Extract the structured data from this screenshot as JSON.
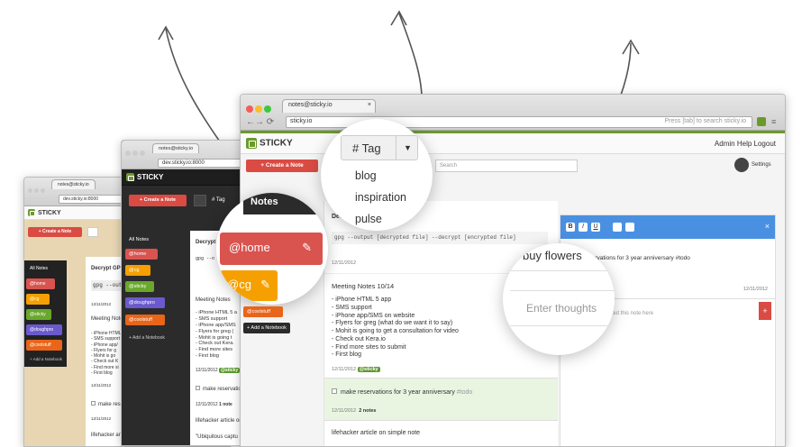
{
  "colors": {
    "brand": "#6a9a2a",
    "red": "#d94b43",
    "home": "#d9534f",
    "cg": "#f5a000",
    "sticky": "#6aa82c",
    "doughpro": "#6a5acd",
    "coolstuff": "#e8651a",
    "modal": "#4a90e2"
  },
  "back": {
    "tab": "notes@sticky.io",
    "url": "dev.sticky.io:8000",
    "logo": "STICKY",
    "create": "+ Create a Note",
    "notebooks": [
      "All Notes",
      "@home",
      "@cg",
      "@sticky",
      "@doughpro",
      "@coolstuff"
    ],
    "add": "+ Add a Notebook",
    "n1_title": "Decrypt GPG",
    "n1_body": "gpg --outpu",
    "n1_date": "12/11/2012",
    "n2_title": "Meeting Notes",
    "n2_lines": [
      "- iPhone HTML",
      "- SMS support",
      "- iPhone app/",
      "- Flyers for g",
      "- Mohit is go",
      "- Check out K",
      "- Find more si",
      "- First blog"
    ],
    "n2_date": "12/11/2012",
    "n3": "make reserv",
    "n3_date": "12/11/2012",
    "n4": "lifehacker art"
  },
  "mid": {
    "tab": "notes@sticky.io",
    "url": "dev.sticky.io:8000",
    "logo": "STICKY",
    "create": "+ Create a Note",
    "tag": "# Tag",
    "notebooks": [
      "All Notes",
      "@home",
      "@cg",
      "@sticky",
      "@doughpro",
      "@coolstuff"
    ],
    "add": "+ Add a Notebook",
    "n1_title": "Decrypt",
    "n1_body": "gpg --o",
    "n2_title": "Meeting Notes",
    "n2_lines": [
      "- iPhone HTML 5 a",
      "- SMS support",
      "- iPhone app/SMS",
      "- Flyers for greg (",
      "- Mohit is going t",
      "- Check out Kera.",
      "- Find more sites",
      "- First blog"
    ],
    "n2_date": "12/11/2012",
    "badge": "@sticky",
    "n3": "make reservatio",
    "n3_date": "12/11/2012",
    "n3_notes": "1 note",
    "n4": "lifehacker article on",
    "n5": "\"Ubiquitous captu"
  },
  "front": {
    "tab": "notes@sticky.io",
    "url": "sticky.io",
    "hint": "Press [tab] to search sticky.io",
    "logo": "STICKY",
    "nav": [
      "Admin",
      "Help",
      "Logout"
    ],
    "create": "+ Create a Note",
    "search_placeholder": "Search",
    "settings": "Settings",
    "n1_title": "Decrypt GPG",
    "n1_body": "gpg --output [decrypted file] --decrypt [encrypted file]",
    "n1_date": "12/11/2012",
    "n2_title": "Meeting Notes 10/14",
    "n2_lines": [
      "- iPhone HTML 5 app",
      "- SMS support",
      "- iPhone app/SMS on website",
      "- Flyers for greg (what do we want it to say)",
      "- Mohit is going to get a consultation for video",
      "- Check out Kera.io",
      "- Find more sites to submit",
      "- First blog"
    ],
    "n2_date": "12/11/2012",
    "badge": "@sticky",
    "n3": "make reservations for 3 year anniversary",
    "n3_tag": "#todo",
    "n3_date": "12/11/2012",
    "n3_notes": "2 notes",
    "n4": "lifehacker article on simple note",
    "modal_text": "make reservations for 3 year anniversary #todo",
    "modal_date": "12/11/2012",
    "modal_note_placeholder": "about this note here",
    "plus": "+"
  },
  "zoom_tag": {
    "button": "# Tag",
    "options": [
      "blog",
      "inspiration",
      "pulse"
    ]
  },
  "zoom_notebooks": {
    "header": "Notes",
    "items": [
      "@home",
      "@cg"
    ]
  },
  "zoom_note": {
    "title": "buy flowers",
    "placeholder": "Enter thoughts"
  },
  "mid_zoomed_sidebar": {
    "items": [
      "@home",
      "@cg",
      "@coolstuff"
    ],
    "add": "+ Add a Notebook"
  }
}
